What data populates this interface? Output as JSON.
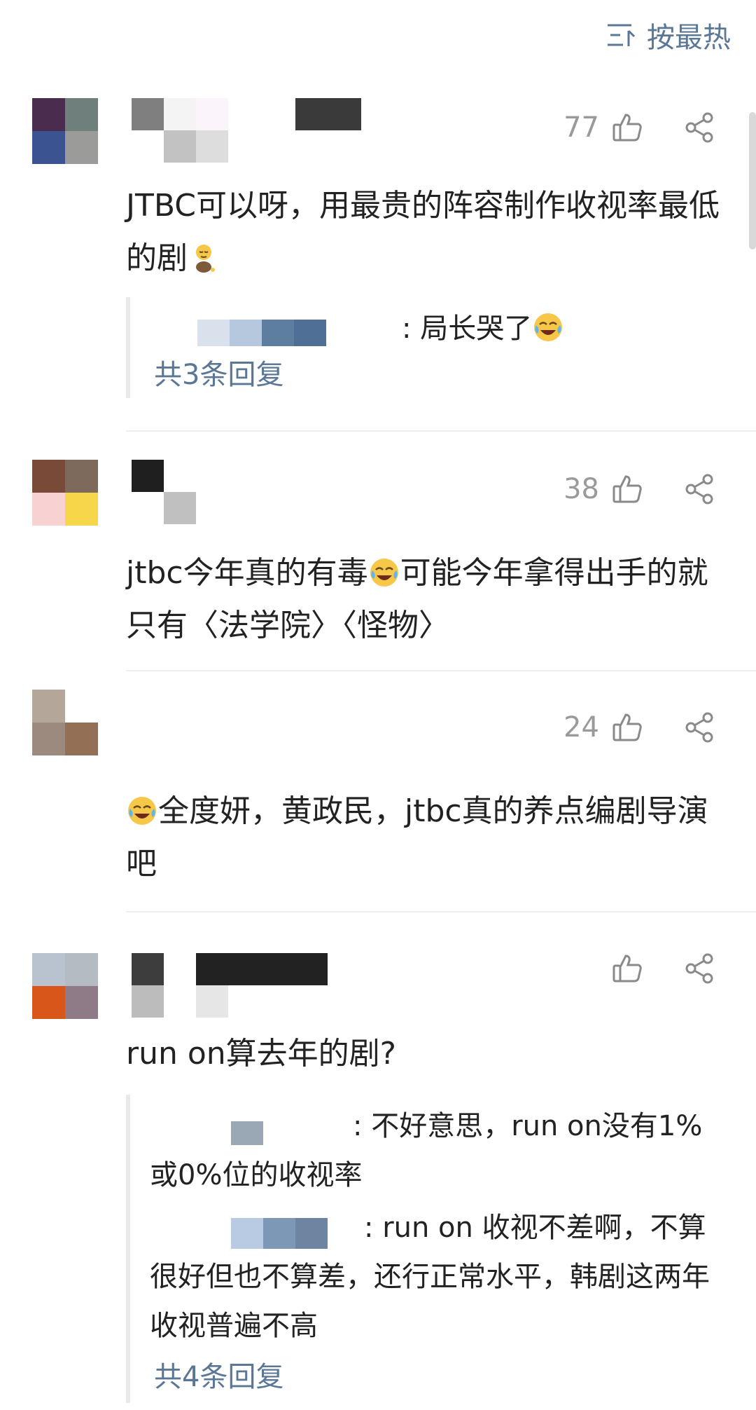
{
  "sort": {
    "label": "按最热",
    "icon": "sort-lines-icon"
  },
  "comments": [
    {
      "likes": "77",
      "text": "JTBC可以呀，用最贵的阵容制作收视率最低的剧",
      "emoji": "pensive-figure-emoji",
      "reply_preview": ": 局长哭了",
      "reply_emoji": "crying-laughing-emoji",
      "reply_count": "共3条回复",
      "avatar_colors": [
        "#4a2c4e",
        "#6f7f7c",
        "#3b5390",
        "#9b9b99"
      ]
    },
    {
      "likes": "38",
      "text_a": "jtbc今年真的有毒",
      "text_b": "可能今年拿得出手的就只有〈法学院〉〈怪物〉",
      "avatar_colors": [
        "#7a4a38",
        "#7d6a5d",
        "#f8d2d2",
        "#f8d64a"
      ]
    },
    {
      "likes": "24",
      "text": "全度妍，黄政民，jtbc真的养点编剧导演吧",
      "avatar_colors": [
        "#b5a69a",
        "#ffffff",
        "#9c8a7e",
        "#937055"
      ]
    },
    {
      "likes": "",
      "text": "run on算去年的剧?",
      "replies": [
        ": 不好意思，run on没有1% 或0%位的收视率",
        ": run on 收视不差啊，不算很好但也不算差，还行正常水平，韩剧这两年收视普遍不高"
      ],
      "reply_count": "共4条回复",
      "avatar_colors": [
        "#b9c3cf",
        "#b4bcc2",
        "#d9561b",
        "#8f7a87"
      ]
    }
  ],
  "colors": {
    "link": "#5b7796",
    "muted": "#9a9a9a",
    "text": "#222222"
  }
}
